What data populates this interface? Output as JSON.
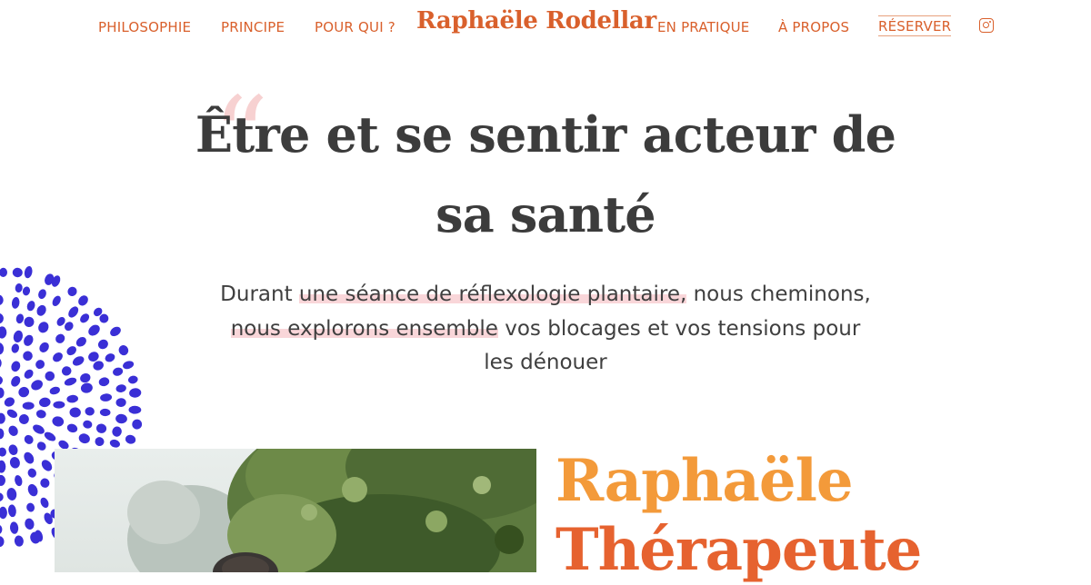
{
  "nav": {
    "left_items": [
      {
        "label": "PHILOSOPHIE"
      },
      {
        "label": "PRINCIPE"
      },
      {
        "label": "POUR QUI ?"
      }
    ],
    "brand": "Raphaële Rodellar",
    "right_items": [
      {
        "label": "EN PRATIQUE"
      },
      {
        "label": "À PROPOS"
      },
      {
        "label": "RÉSERVER"
      }
    ],
    "social_icon": "instagram-icon"
  },
  "hero": {
    "quote_glyph": "“",
    "headline_line1": "Être et se sentir acteur de",
    "headline_line2": "sa santé",
    "text": {
      "p1": "Durant ",
      "h1": "une séance de réflexologie plantaire,",
      "p2": " nous cheminons, ",
      "h2": "nous explorons ensemble",
      "p3": " vos blocages et vos tensions pour les dénouer"
    }
  },
  "profile": {
    "title_line1": "Raphaële",
    "title_line2": "Thérapeute"
  },
  "colors": {
    "accent": "#d9602c",
    "title_orange": "#f39a3a",
    "title_red": "#e6622f",
    "highlight": "#f9d6d9",
    "dots_blue": "#3a2fd6",
    "text": "#3c3c3c"
  }
}
